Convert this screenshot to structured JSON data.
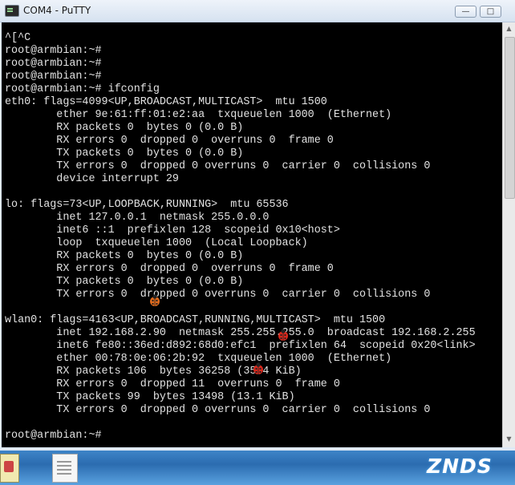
{
  "window": {
    "title": "COM4 - PuTTY",
    "minimize_glyph": "—",
    "maximize_glyph": "□"
  },
  "terminal": {
    "lines": [
      "^[^C",
      "root@armbian:~#",
      "root@armbian:~#",
      "root@armbian:~#",
      "root@armbian:~# ifconfig",
      "eth0: flags=4099<UP,BROADCAST,MULTICAST>  mtu 1500",
      "        ether 9e:61:ff:01:e2:aa  txqueuelen 1000  (Ethernet)",
      "        RX packets 0  bytes 0 (0.0 B)",
      "        RX errors 0  dropped 0  overruns 0  frame 0",
      "        TX packets 0  bytes 0 (0.0 B)",
      "        TX errors 0  dropped 0 overruns 0  carrier 0  collisions 0",
      "        device interrupt 29",
      "",
      "lo: flags=73<UP,LOOPBACK,RUNNING>  mtu 65536",
      "        inet 127.0.0.1  netmask 255.0.0.0",
      "        inet6 ::1  prefixlen 128  scopeid 0x10<host>",
      "        loop  txqueuelen 1000  (Local Loopback)",
      "        RX packets 0  bytes 0 (0.0 B)",
      "        RX errors 0  dropped 0  overruns 0  frame 0",
      "        TX packets 0  bytes 0 (0.0 B)",
      "        TX errors 0  dropped 0 overruns 0  carrier 0  collisions 0",
      "",
      "wlan0: flags=4163<UP,BROADCAST,RUNNING,MULTICAST>  mtu 1500",
      "        inet 192.168.2.90  netmask 255.255.255.0  broadcast 192.168.2.255",
      "        inet6 fe80::36ed:d892:68d0:efc1  prefixlen 64  scopeid 0x20<link>",
      "        ether 00:78:0e:06:2b:92  txqueuelen 1000  (Ethernet)",
      "        RX packets 106  bytes 36258 (35.4 KiB)",
      "        RX errors 0  dropped 11  overruns 0  frame 0",
      "        TX packets 99  bytes 13498 (13.1 KiB)",
      "        TX errors 0  dropped 0 overruns 0  carrier 0  collisions 0",
      "",
      "root@armbian:~#"
    ]
  },
  "taskbar": {
    "watermark_logo": "ZNDS"
  },
  "colors": {
    "terminal_bg": "#000000",
    "terminal_fg": "#e2e2e2",
    "taskbar_blue": "#2b6cb0",
    "ladybug_red": "#d8281c"
  }
}
